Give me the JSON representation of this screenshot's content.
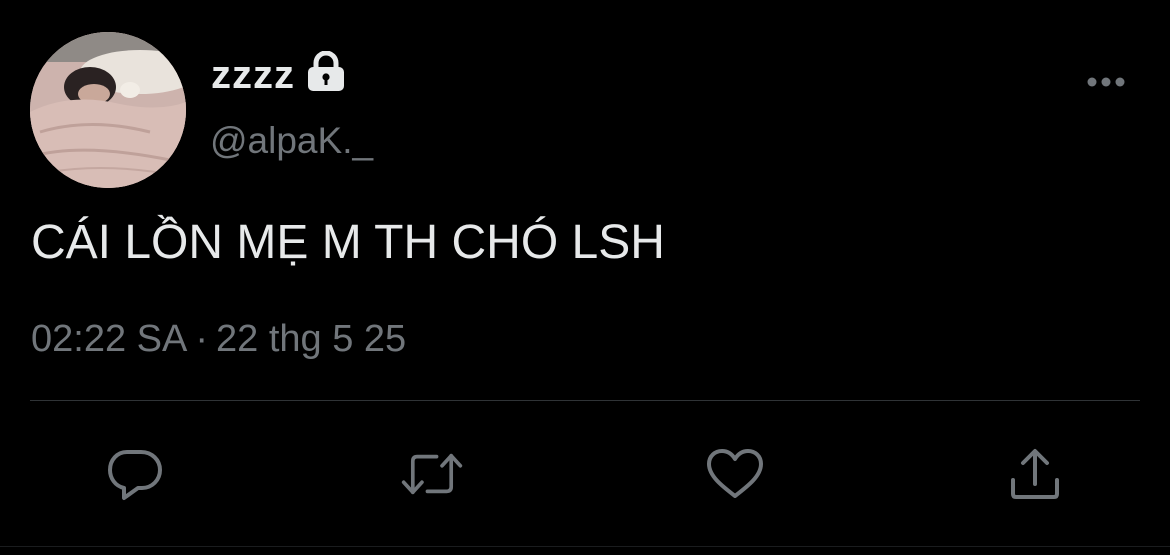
{
  "tweet": {
    "display_name": "zzzz",
    "handle": "@alpaK._",
    "text": "CÁI LỒN MẸ M TH CHÓ LSH",
    "time": "02:22 SA",
    "separator": "·",
    "date": "22 thg 5 25",
    "protected_icon": "lock-icon",
    "more_icon": "more-dots-icon"
  },
  "actions": [
    {
      "name": "reply",
      "icon": "comment-icon"
    },
    {
      "name": "retweet",
      "icon": "retweet-icon"
    },
    {
      "name": "like",
      "icon": "heart-icon"
    },
    {
      "name": "share",
      "icon": "share-icon"
    }
  ],
  "colors": {
    "background": "#000000",
    "primary_text": "#e7e9ea",
    "secondary_text": "#71767b",
    "divider": "#2f3336"
  }
}
